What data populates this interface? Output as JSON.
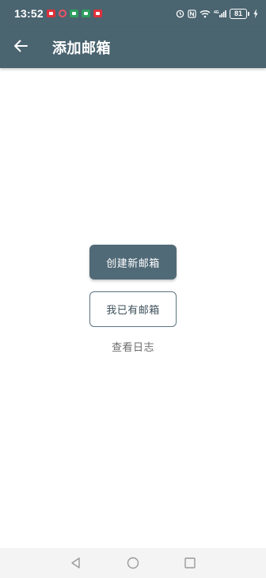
{
  "status_bar": {
    "time": "13:52",
    "notification_icons": [
      "message-icon",
      "target-icon",
      "store-icon",
      "store-icon",
      "message-icon"
    ],
    "battery": "81",
    "network_label": "4G"
  },
  "app_bar": {
    "title": "添加邮箱"
  },
  "main": {
    "create_button": "创建新邮箱",
    "existing_button": "我已有邮箱",
    "view_log_link": "查看日志"
  },
  "colors": {
    "app_bar": "#4a6470",
    "primary_button": "#516a77",
    "outline_border": "#5d7480"
  }
}
